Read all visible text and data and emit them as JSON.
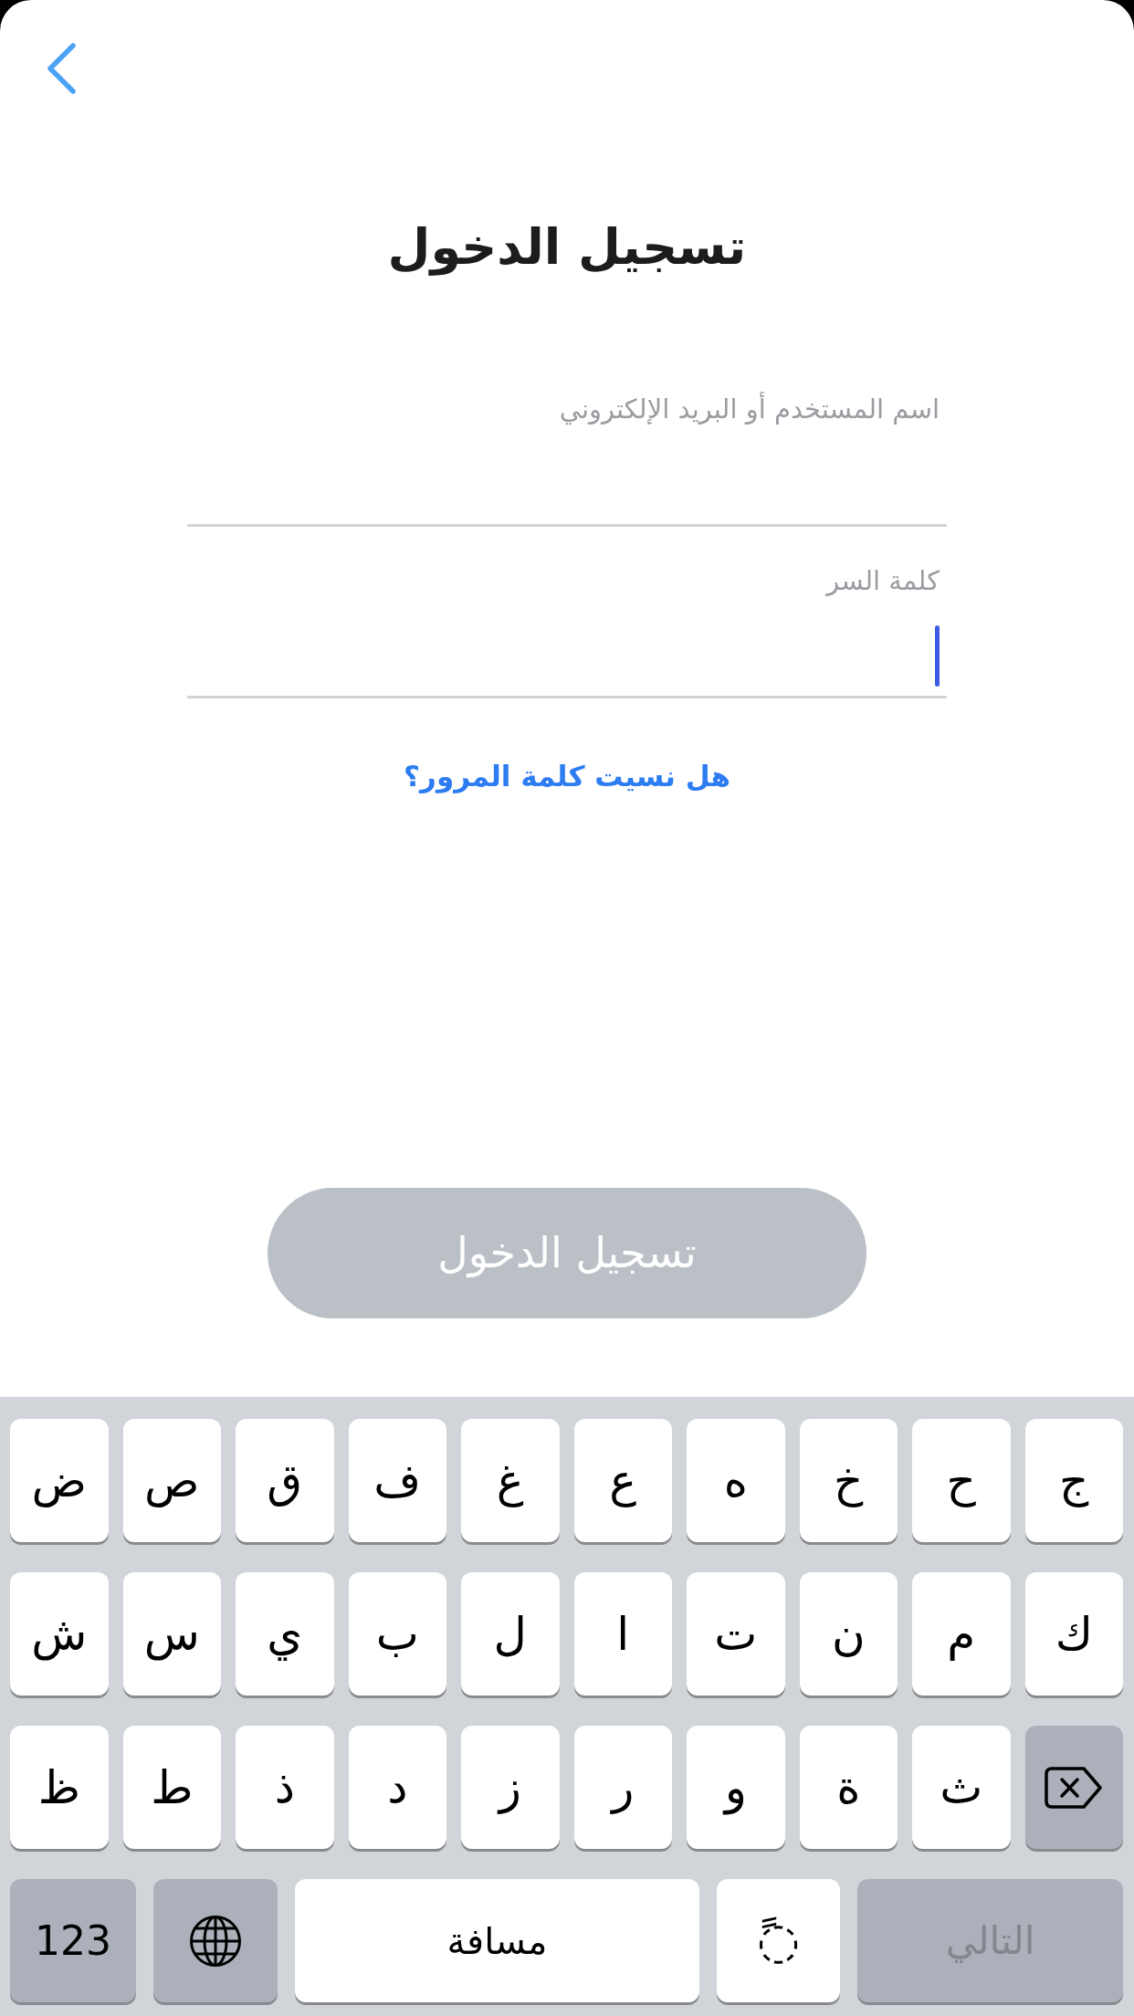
{
  "title": "تسجيل الدخول",
  "form": {
    "fields": [
      {
        "label": "اسم المستخدم أو البريد الإلكتروني",
        "focused": false
      },
      {
        "label": "كلمة السر",
        "focused": true
      }
    ],
    "forgot_link": "هل نسيت كلمة المرور؟"
  },
  "login_button": {
    "label": "تسجيل الدخول",
    "disabled": true
  },
  "keyboard": {
    "rows": [
      {
        "keys": [
          {
            "kind": "letter",
            "label": "ج"
          },
          {
            "kind": "letter",
            "label": "ح"
          },
          {
            "kind": "letter",
            "label": "خ"
          },
          {
            "kind": "letter",
            "label": "ه"
          },
          {
            "kind": "letter",
            "label": "ع"
          },
          {
            "kind": "letter",
            "label": "غ"
          },
          {
            "kind": "letter",
            "label": "ف"
          },
          {
            "kind": "letter",
            "label": "ق"
          },
          {
            "kind": "letter",
            "label": "ص"
          },
          {
            "kind": "letter",
            "label": "ض"
          }
        ]
      },
      {
        "keys": [
          {
            "kind": "letter",
            "label": "ك"
          },
          {
            "kind": "letter",
            "label": "م"
          },
          {
            "kind": "letter",
            "label": "ن"
          },
          {
            "kind": "letter",
            "label": "ت"
          },
          {
            "kind": "letter",
            "label": "ا"
          },
          {
            "kind": "letter",
            "label": "ل"
          },
          {
            "kind": "letter",
            "label": "ب"
          },
          {
            "kind": "letter",
            "label": "ي"
          },
          {
            "kind": "letter",
            "label": "س"
          },
          {
            "kind": "letter",
            "label": "ش"
          }
        ]
      },
      {
        "keys": [
          {
            "kind": "delete"
          },
          {
            "kind": "letter",
            "label": "ث"
          },
          {
            "kind": "letter",
            "label": "ة"
          },
          {
            "kind": "letter",
            "label": "و"
          },
          {
            "kind": "letter",
            "label": "ر"
          },
          {
            "kind": "letter",
            "label": "ز"
          },
          {
            "kind": "letter",
            "label": "د"
          },
          {
            "kind": "letter",
            "label": "ذ"
          },
          {
            "kind": "letter",
            "label": "ط"
          },
          {
            "kind": "letter",
            "label": "ظ"
          }
        ]
      },
      {
        "keys": [
          {
            "kind": "return",
            "label": "التالي",
            "disabled": true
          },
          {
            "kind": "diacritic",
            "label": "◌ً"
          },
          {
            "kind": "space",
            "label": "مسافة"
          },
          {
            "kind": "globe"
          },
          {
            "kind": "numbers",
            "label": "123"
          }
        ]
      }
    ]
  }
}
